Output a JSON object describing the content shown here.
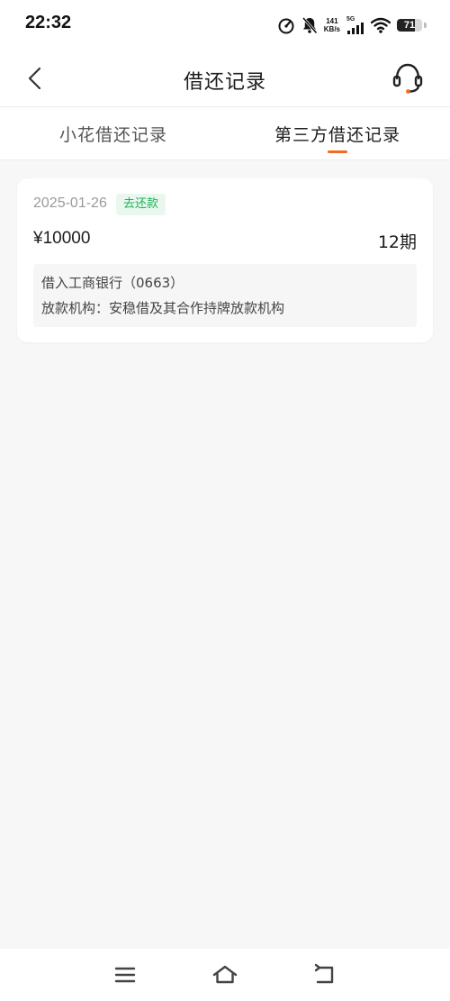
{
  "status_bar": {
    "time": "22:32",
    "net_speed_value": "141",
    "net_speed_unit": "KB/s",
    "network_type": "5G",
    "battery_level": "71",
    "icons": [
      "speedometer-icon",
      "bell-muted-icon",
      "signal-icon",
      "wifi-icon",
      "battery-icon"
    ]
  },
  "header": {
    "title": "借还记录",
    "back_icon": "chevron-left-icon",
    "service_icon": "headset-icon"
  },
  "tabs": [
    {
      "label": "小花借还记录",
      "active": false
    },
    {
      "label": "第三方借还记录",
      "active": true
    }
  ],
  "colors": {
    "accent": "#f06b1f",
    "badge_text": "#20b159",
    "badge_bg": "#e9f8ee",
    "page_bg": "#f7f7f7"
  },
  "records": [
    {
      "date": "2025-01-26",
      "status": "去还款",
      "amount": "¥10000",
      "term": "12期",
      "bank_line": "借入工商银行（0663）",
      "lender_line": "放款机构：安稳借及其合作持牌放款机构"
    }
  ],
  "nav_bar": {
    "icons": [
      "menu-icon",
      "home-icon",
      "back-icon"
    ]
  }
}
